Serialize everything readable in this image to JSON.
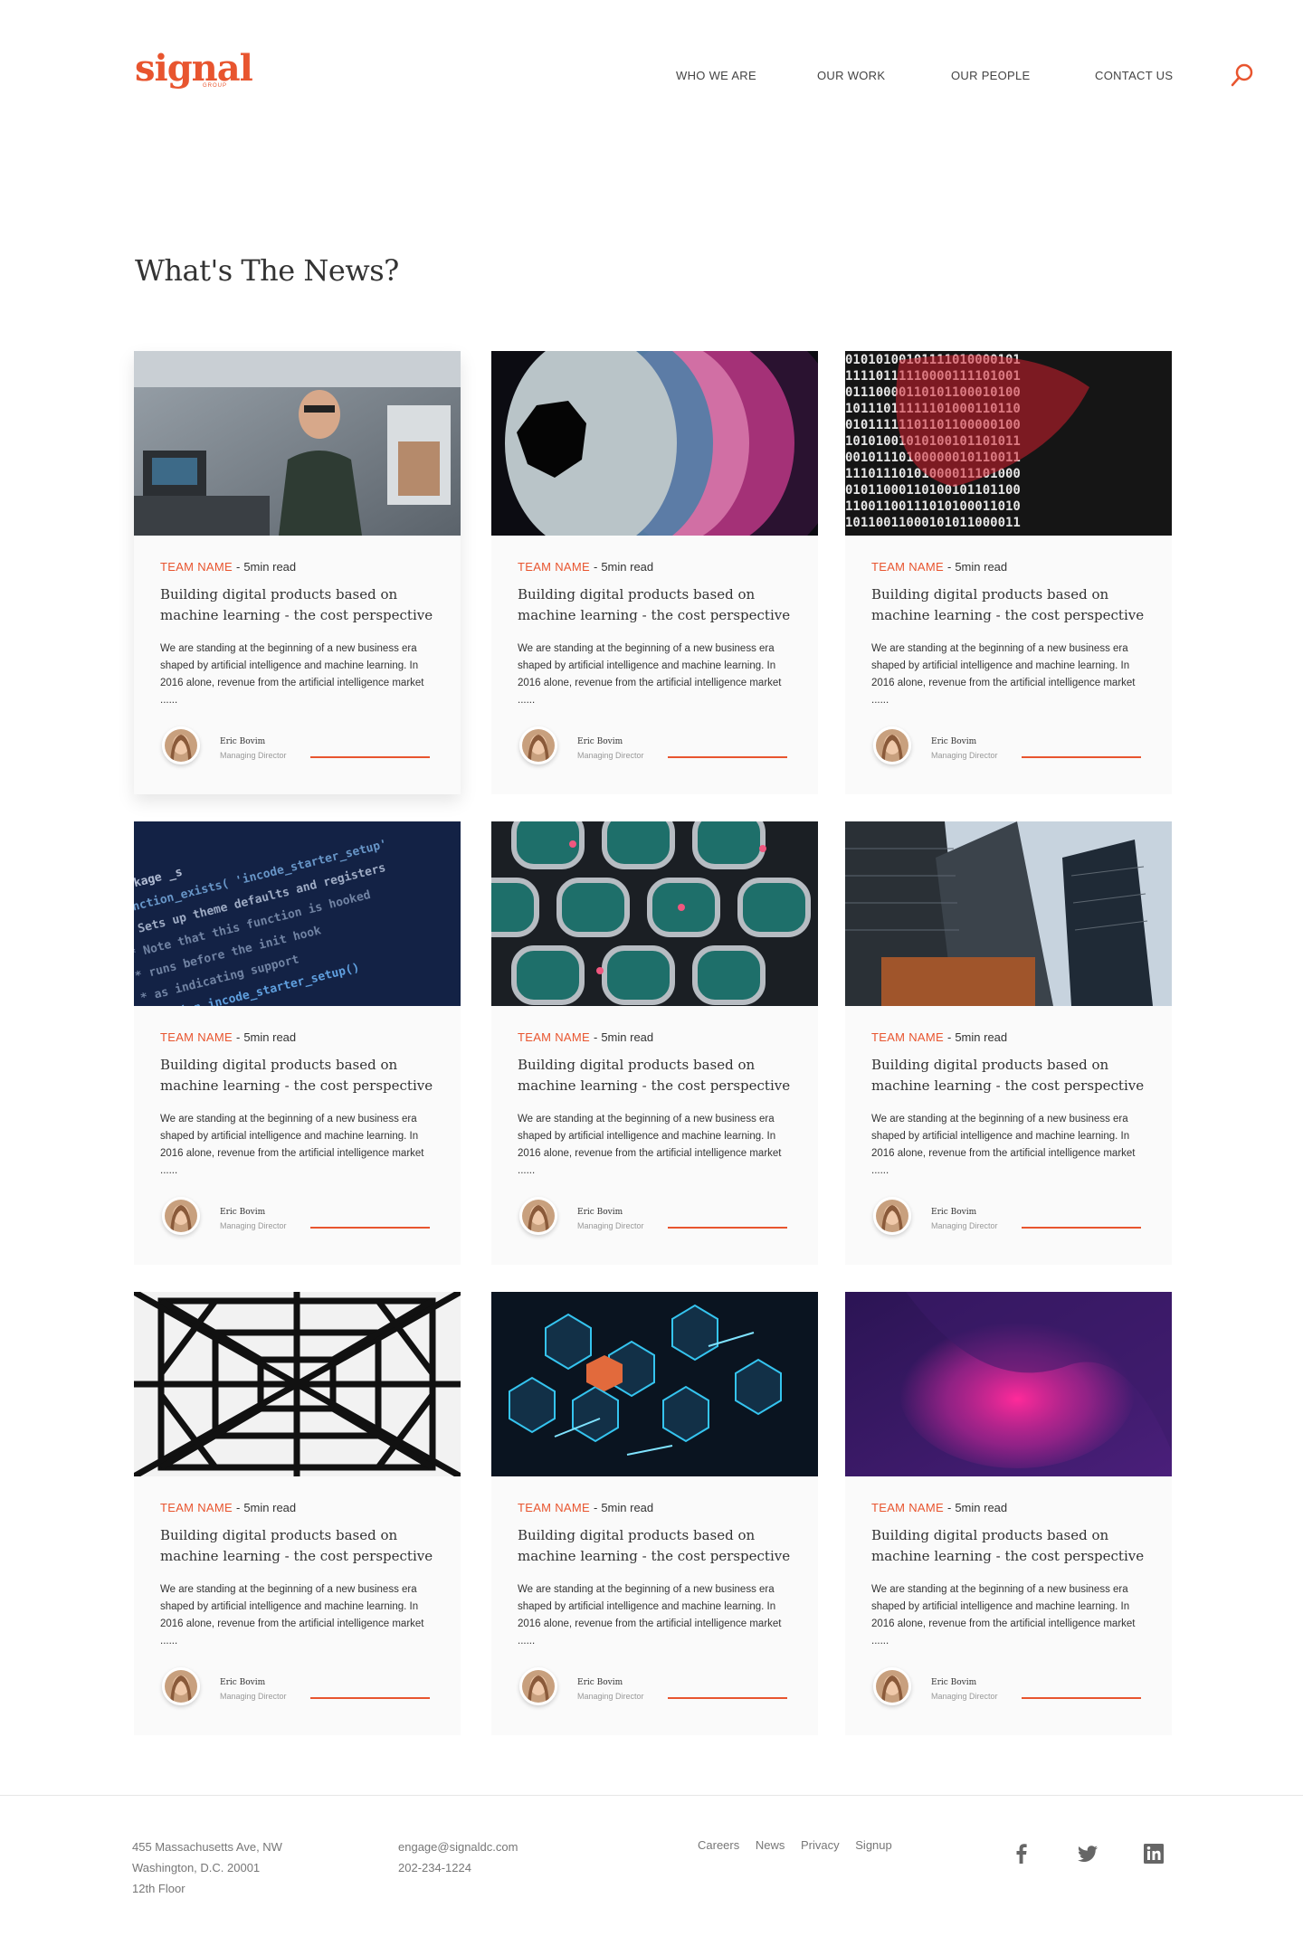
{
  "brand": {
    "name": "signal",
    "sub": "GROUP",
    "accent": "#e8552f"
  },
  "nav": {
    "items": [
      "WHO WE ARE",
      "OUR WORK",
      "OUR PEOPLE",
      "CONTACT US"
    ],
    "search_icon": "search-icon"
  },
  "page": {
    "title": "What's The News?"
  },
  "cards": [
    {
      "image": "man-in-office-photo",
      "team": "TEAM NAME",
      "read": "5min read",
      "title": "Building digital products based on machine learning - the cost perspective",
      "excerpt": "We are standing at the beginning of a new business era shaped by artificial intelligence and machine learning. In 2016 alone, revenue from the artificial intelligence market ......",
      "author": "Eric Bovim",
      "role": "Managing Director"
    },
    {
      "image": "camera-lens-photo",
      "team": "TEAM NAME",
      "read": "5min read",
      "title": "Building digital products based on machine learning - the cost perspective",
      "excerpt": "We are standing at the beginning of a new business era shaped by artificial intelligence and machine learning. In 2016 alone, revenue from the artificial intelligence market ......",
      "author": "Eric Bovim",
      "role": "Managing Director"
    },
    {
      "image": "binary-code-photo",
      "team": "TEAM NAME",
      "read": "5min read",
      "title": "Building digital products based on machine learning - the cost perspective",
      "excerpt": "We are standing at the beginning of a new business era shaped by artificial intelligence and machine learning. In 2016 alone, revenue from the artificial intelligence market ......",
      "author": "Eric Bovim",
      "role": "Managing Director"
    },
    {
      "image": "source-code-photo",
      "team": "TEAM NAME",
      "read": "5min read",
      "title": "Building digital products based on machine learning - the cost perspective",
      "excerpt": "We are standing at the beginning of a new business era shaped by artificial intelligence and machine learning. In 2016 alone, revenue from the artificial intelligence market ......",
      "author": "Eric Bovim",
      "role": "Managing Director"
    },
    {
      "image": "monitor-grid-photo",
      "team": "TEAM NAME",
      "read": "5min read",
      "title": "Building digital products based on machine learning - the cost perspective",
      "excerpt": "We are standing at the beginning of a new business era shaped by artificial intelligence and machine learning. In 2016 alone, revenue from the artificial intelligence market ......",
      "author": "Eric Bovim",
      "role": "Managing Director"
    },
    {
      "image": "skyscrapers-photo",
      "team": "TEAM NAME",
      "read": "5min read",
      "title": "Building digital products based on machine learning - the cost perspective",
      "excerpt": "We are standing at the beginning of a new business era shaped by artificial intelligence and machine learning. In 2016 alone, revenue from the artificial intelligence market ......",
      "author": "Eric Bovim",
      "role": "Managing Director"
    },
    {
      "image": "steel-tower-photo",
      "team": "TEAM NAME",
      "read": "5min read",
      "title": "Building digital products based on machine learning - the cost perspective",
      "excerpt": "We are standing at the beginning of a new business era shaped by artificial intelligence and machine learning. In 2016 alone, revenue from the artificial intelligence market ......",
      "author": "Eric Bovim",
      "role": "Managing Director"
    },
    {
      "image": "neon-hexagons-photo",
      "team": "TEAM NAME",
      "read": "5min read",
      "title": "Building digital products based on machine learning - the cost perspective",
      "excerpt": "We are standing at the beginning of a new business era shaped by artificial intelligence and machine learning. In 2016 alone, revenue from the artificial intelligence market ......",
      "author": "Eric Bovim",
      "role": "Managing Director"
    },
    {
      "image": "pink-abstract-photo",
      "team": "TEAM NAME",
      "read": "5min read",
      "title": "Building digital products based on machine learning - the cost perspective",
      "excerpt": "We are standing at the beginning of a new business era shaped by artificial intelligence and machine learning. In 2016 alone, revenue from the artificial intelligence market ......",
      "author": "Eric Bovim",
      "role": "Managing Director"
    }
  ],
  "footer": {
    "address": [
      "455 Massachusetts Ave, NW",
      "Washington, D.C. 20001",
      "12th Floor"
    ],
    "contact": [
      "engage@signaldc.com",
      "202-234-1224"
    ],
    "links": [
      "Careers",
      "News",
      "Privacy",
      "Signup"
    ],
    "social": [
      "facebook-icon",
      "twitter-icon",
      "linkedin-icon"
    ]
  }
}
